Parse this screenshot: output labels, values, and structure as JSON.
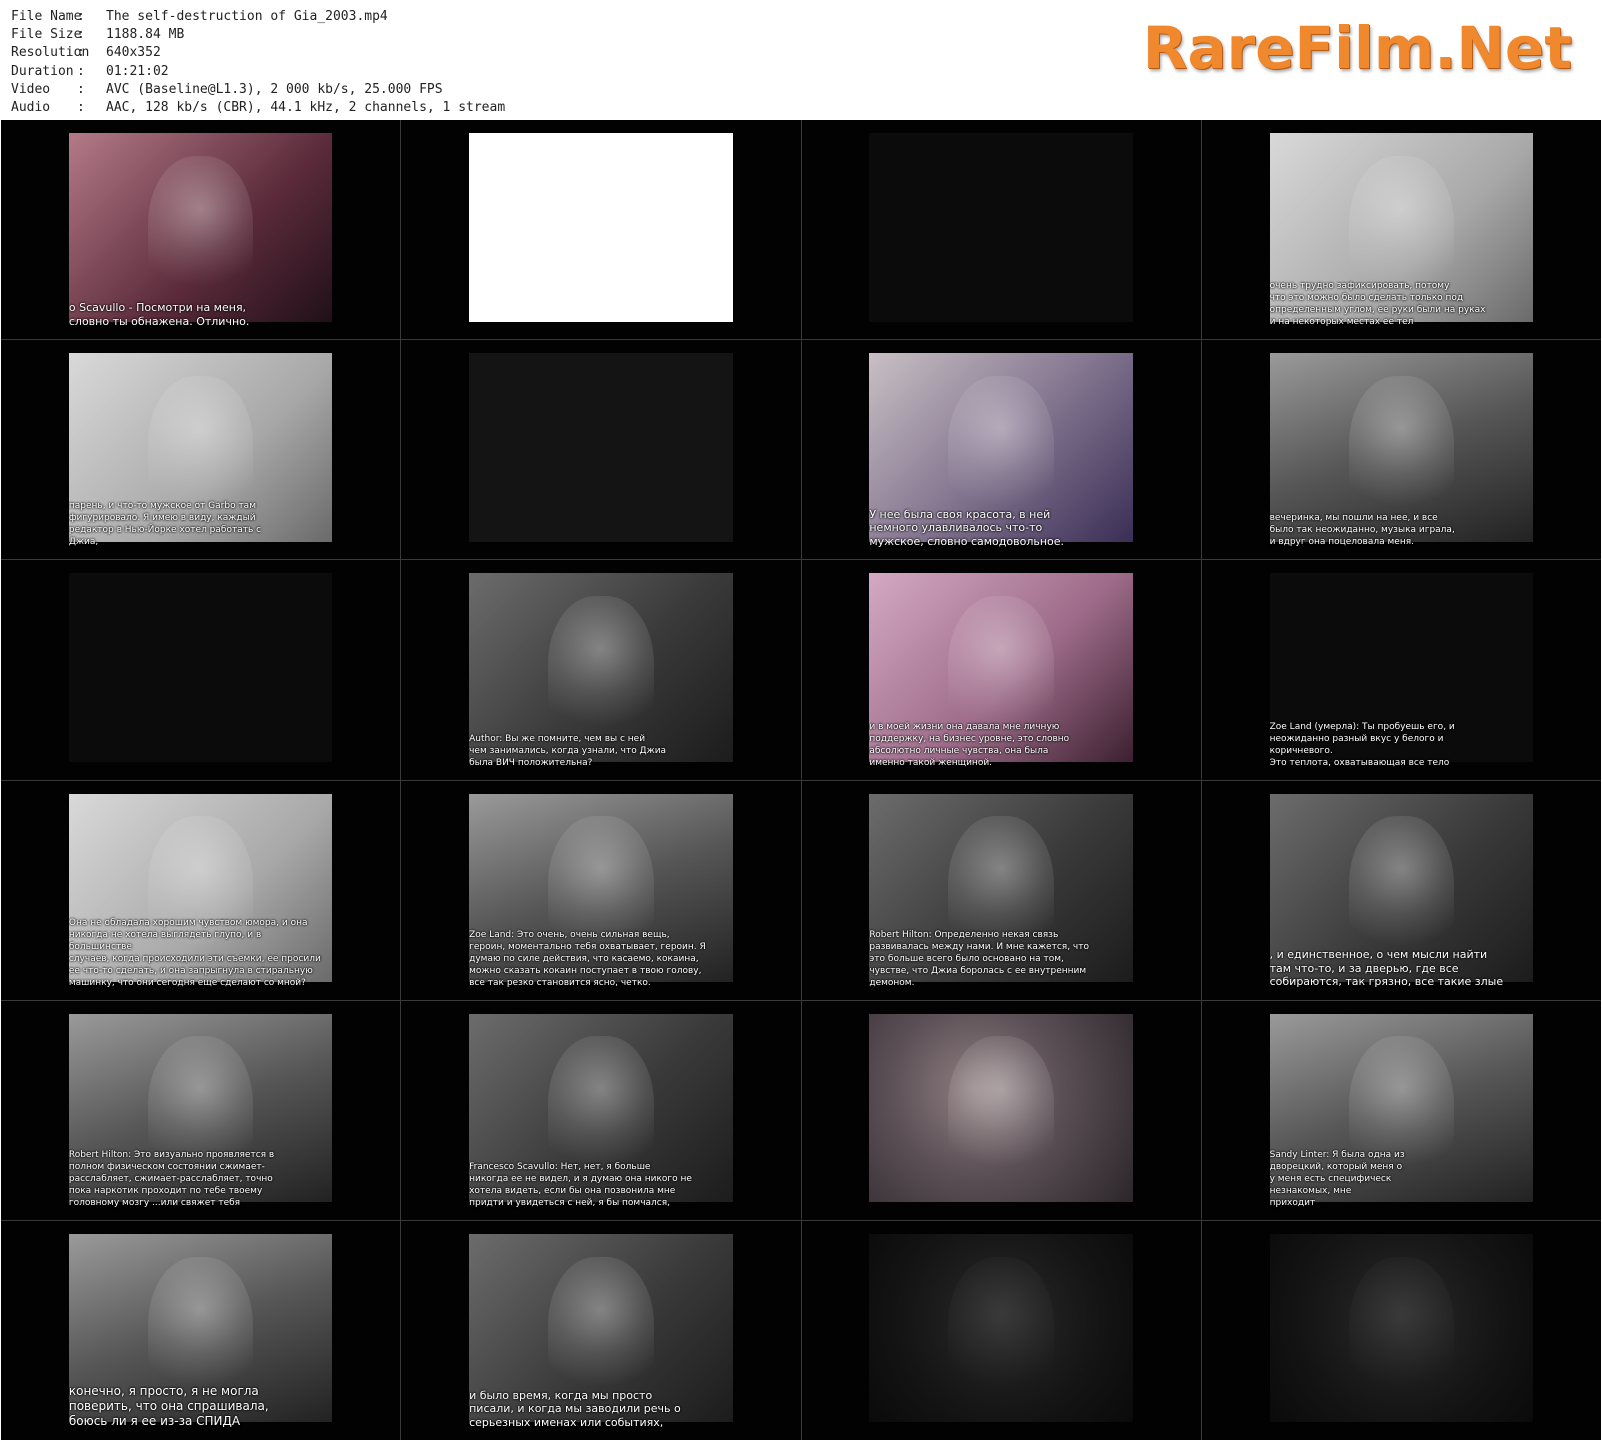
{
  "meta": {
    "rows": [
      {
        "key": "File Name",
        "sep": ":",
        "value": "The self-destruction of Gia_2003.mp4"
      },
      {
        "key": "File Size",
        "sep": ":",
        "value": "1188.84 MB"
      },
      {
        "key": "Resolution",
        "sep": ":",
        "value": "640x352"
      },
      {
        "key": "Duration",
        "sep": ":",
        "value": "01:21:02"
      },
      {
        "key": "Video",
        "sep": ":",
        "value": "AVC (Baseline@L1.3), 2 000 kb/s, 25.000 FPS"
      },
      {
        "key": "Audio",
        "sep": ":",
        "value": "AAC, 128 kb/s (CBR), 44.1 kHz, 2 channels, 1 stream"
      }
    ]
  },
  "logo": {
    "text": "RareFilm.Net",
    "color": "#f0882e"
  },
  "thumbnails": [
    {
      "subtitle": "о Scavullo - Посмотри на меня,\nсловно ты обнажена. Отлично."
    },
    {
      "subtitle": ""
    },
    {
      "subtitle": ""
    },
    {
      "subtitle": "очень трудно зафиксировать, потому\nчто это можно было сделать только под\nопределенным углом, ее руки были на руках\nи на некоторых местах ее тел"
    },
    {
      "subtitle": "парень, и что-то мужское от Garbo там\nфигурировало. Я имею в виду, каждый\nредактор в Нью-Йорке хотел работать с\nДжиа,"
    },
    {
      "subtitle": ""
    },
    {
      "subtitle": "У нее была своя красота, в ней\nнемного улавливалось что-то\nмужское, словно самодовольное."
    },
    {
      "subtitle": "вечеринка, мы пошли на нее, и все\nбыло так неожиданно, музыка играла,\nи  вдруг она поцеловала меня."
    },
    {
      "subtitle": ""
    },
    {
      "subtitle": "Author: Вы же помните, чем вы с ней\nчем занимались, когда узнали, что Джиа\nбыла ВИЧ положительна?"
    },
    {
      "subtitle": "и в моей жизни она давала мне личную\nподдержку, на бизнес уровне, это словно\nабсолютно личные чувства, она была\nименно такой женщиной."
    },
    {
      "subtitle": "Zoe Land (умерла): Ты пробуешь его, и\nнеожиданно разный вкус у белого и\nкоричневого.\nЭто теплота, охватывающая все тело"
    },
    {
      "subtitle": "Она не обладала хорошим чувством юмора, и она\nникогда не хотела выглядеть глупо, и в большинстве\nслучаев, когда происходили эти съемки, ее просили\nее что-то сделать, и она запрыгнула в стиральную\nмашинку, что они сегодня еще сделают со мной?"
    },
    {
      "subtitle": "Zoe Land: Это очень, очень сильная вещь,\nгероин, моментально тебя охватывает, героин. Я\nдумаю по силе действия, что касаемо, кокаина,\nможно сказать кокаин поступает в твою голову,\nвсе так резко становится ясно, четко."
    },
    {
      "subtitle": "Robert Hilton: Определенно некая связь\nразвивалась между нами. И мне кажется, что\nэто больше всего было основано на том,\nчувстве, что Джиа боролась с ее внутренним\nдемоном."
    },
    {
      "subtitle": ", и единственное, о чем мысли найти\nтам что-то, и за дверью, где все\nсобираются, так грязно, все такие злые"
    },
    {
      "subtitle": "Robert Hilton: Это визуально проявляется в\nполном физическом состоянии сжимает-\nрасслабляет, сжимает-расслабляет, точно\nпока наркотик проходит по тебе твоему\nголовному мозгу ...или свяжет тебя"
    },
    {
      "subtitle": "Francesco Scavullo: Нет, нет, я больше\nникогда ее не видел, и я думаю она никого не\nхотела видеть, если бы она позвонила мне\nпридти и увидеться с ней, я бы помчался,"
    },
    {
      "subtitle": ""
    },
    {
      "subtitle": "Sandy Linter: Я была одна из\nдворецкий, который меня о\nу меня есть специфическ\nнезнакомых, мне\nприходит"
    },
    {
      "subtitle": "конечно, я просто, я не могла\nповерить, что она спрашивала,\nбоюсь ли я ее из-за СПИДА"
    },
    {
      "subtitle": "и было время, когда мы просто\nписали, и когда мы заводили речь о\nсерьезных именах или событиях,"
    },
    {
      "subtitle": ""
    },
    {
      "subtitle": ""
    }
  ]
}
